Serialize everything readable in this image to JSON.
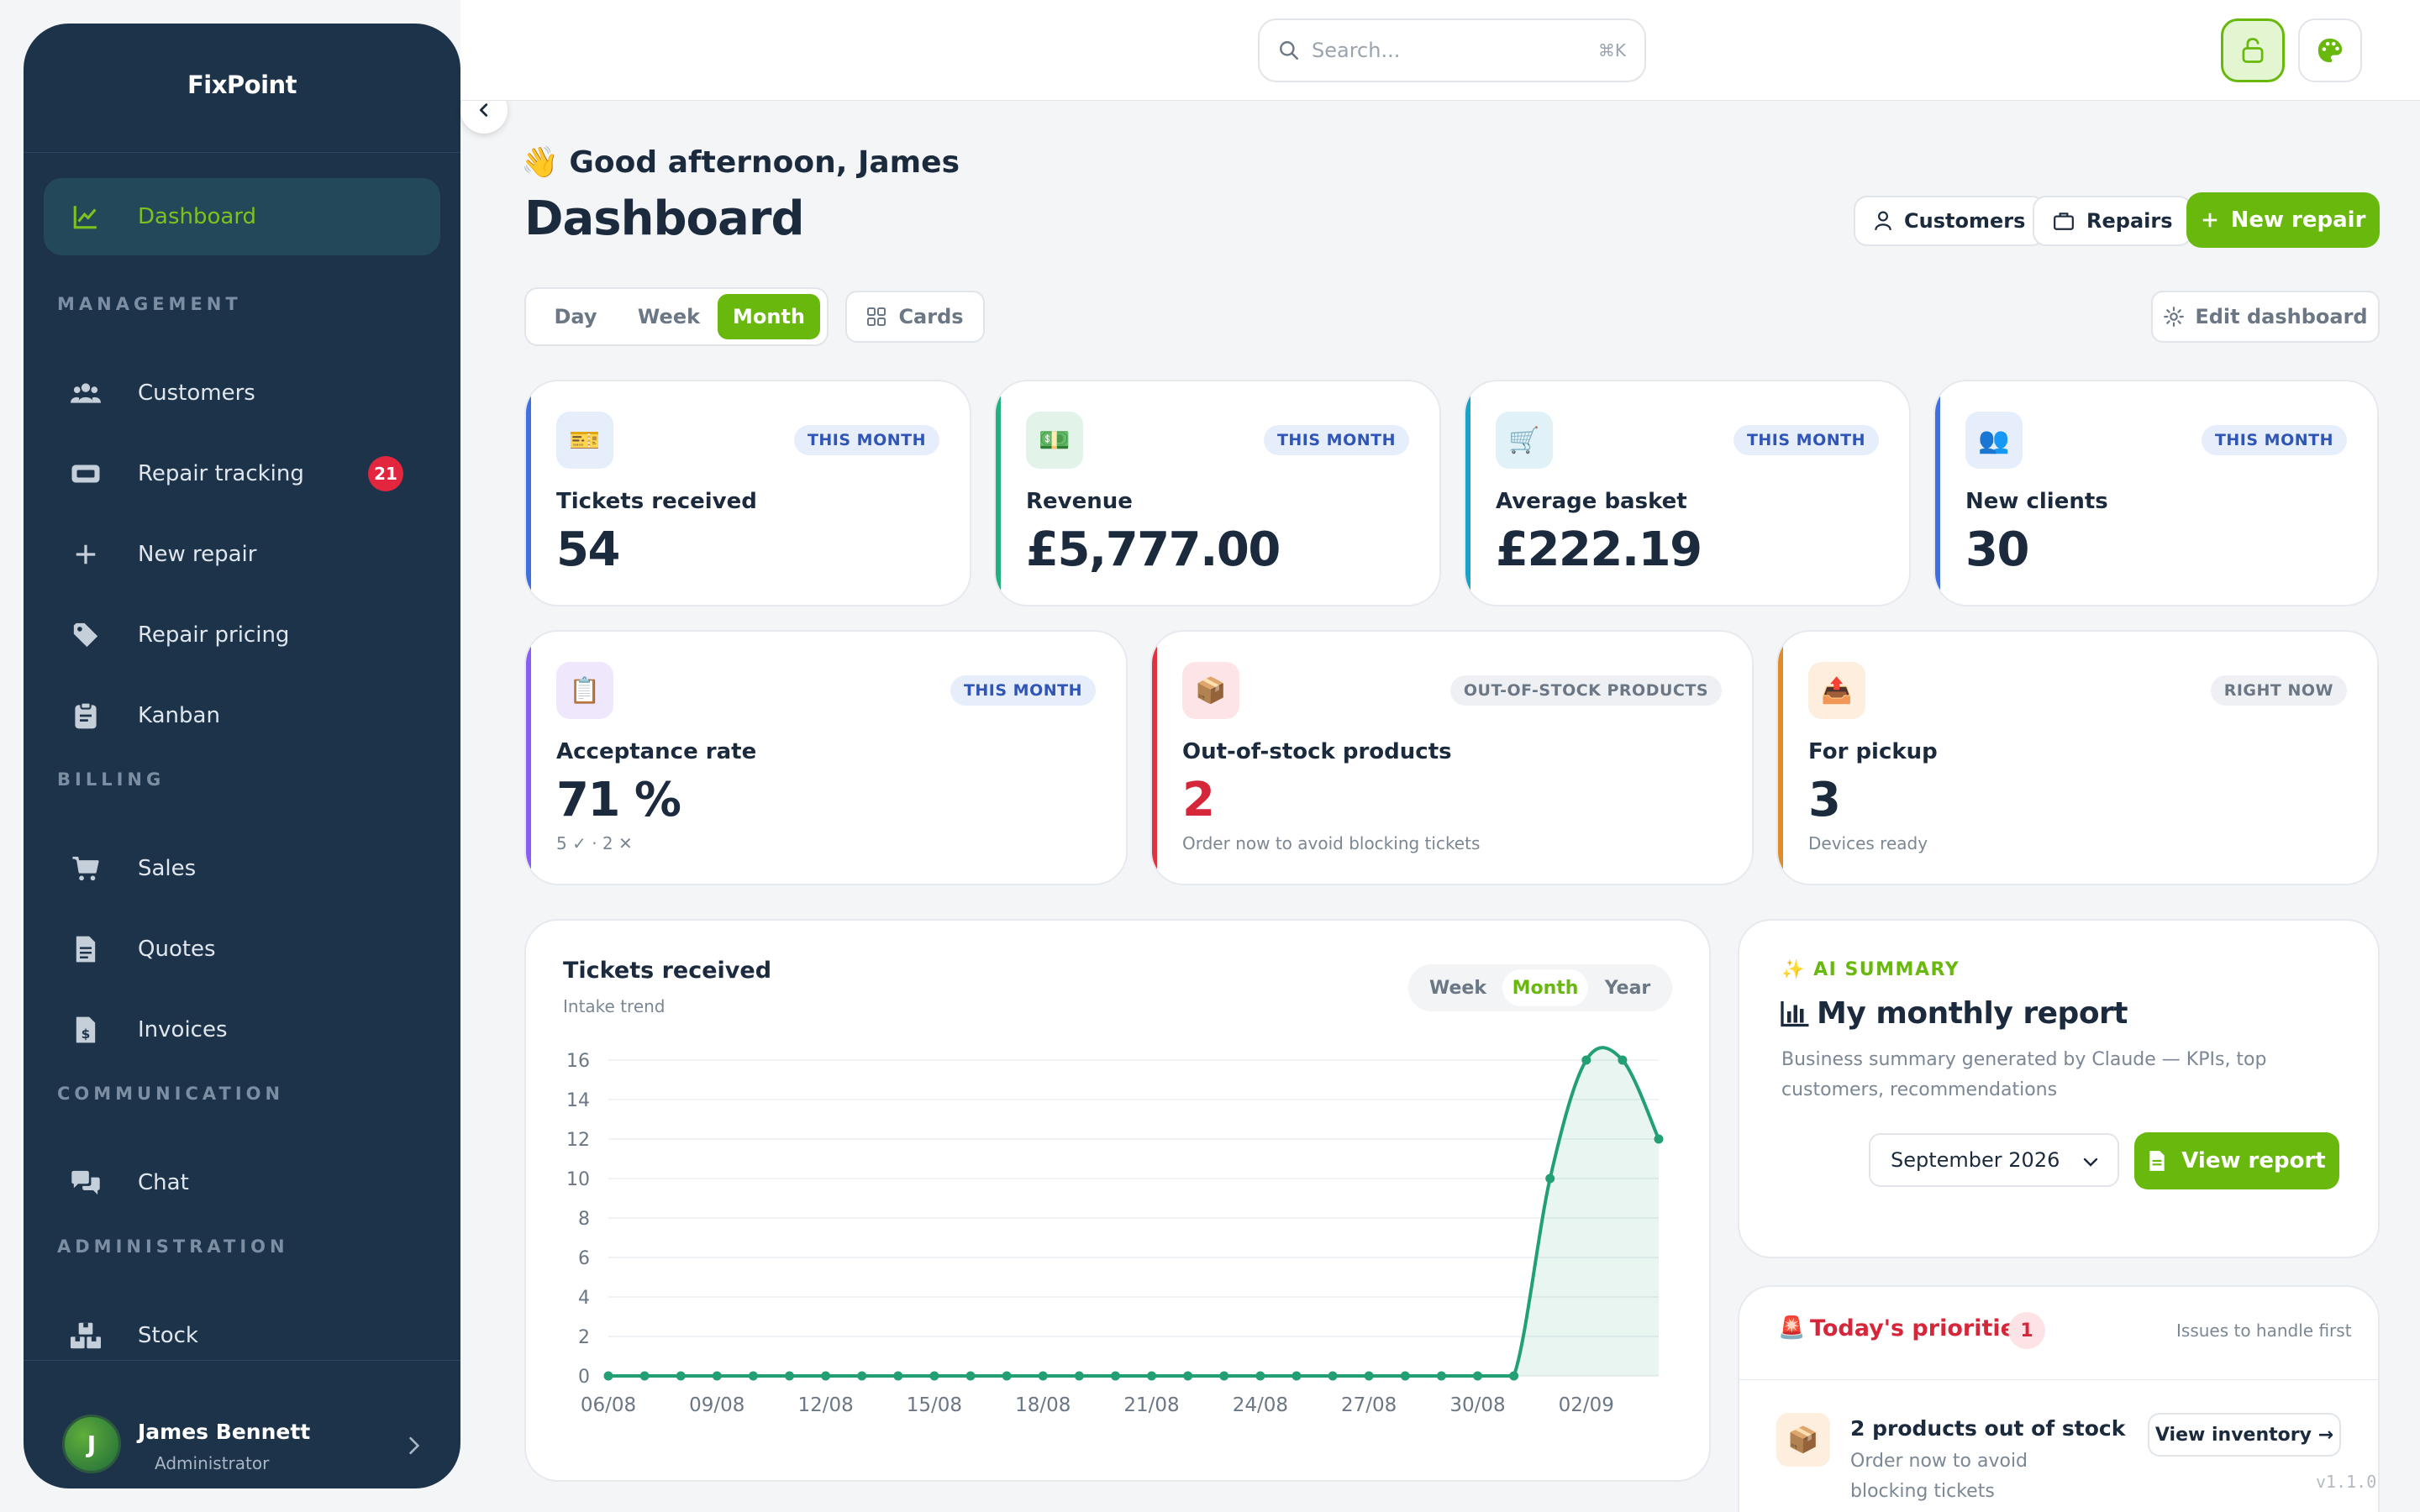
{
  "app": {
    "brand": "FixPoint"
  },
  "sidebar": {
    "items": [
      {
        "label": "Dashboard"
      },
      {
        "label": "Customers"
      },
      {
        "label": "Repair tracking",
        "badge": "21"
      },
      {
        "label": "New repair"
      },
      {
        "label": "Repair pricing"
      },
      {
        "label": "Kanban"
      },
      {
        "label": "Sales"
      },
      {
        "label": "Quotes"
      },
      {
        "label": "Invoices"
      },
      {
        "label": "Chat"
      },
      {
        "label": "Stock"
      }
    ],
    "sections": {
      "management": "MANAGEMENT",
      "billing": "BILLING",
      "communication": "COMMUNICATION",
      "administration": "ADMINISTRATION"
    },
    "user": {
      "initial": "J",
      "name": "James Bennett",
      "role": "Administrator"
    }
  },
  "topbar": {
    "search_placeholder": "Search...",
    "search_shortcut": "⌘K"
  },
  "header": {
    "greeting_emoji": "👋",
    "greeting": "Good afternoon, James",
    "title": "Dashboard",
    "customers_button": "Customers",
    "repairs_button": "Repairs",
    "new_repair_button": "New repair"
  },
  "period": {
    "options": [
      "Day",
      "Week",
      "Month"
    ],
    "selected": "Month",
    "cards_button": "Cards",
    "edit_button": "Edit dashboard"
  },
  "kpis": [
    {
      "icon": "🎫",
      "tag": "THIS MONTH",
      "label": "Tickets received",
      "value": "54",
      "accent": "#3f6fe0"
    },
    {
      "icon": "💵",
      "tag": "THIS MONTH",
      "label": "Revenue",
      "value": "£5,777.00",
      "accent": "#22b07d"
    },
    {
      "icon": "🛒",
      "tag": "THIS MONTH",
      "label": "Average basket",
      "value": "£222.19",
      "accent": "#1aa3c9"
    },
    {
      "icon": "👥",
      "tag": "THIS MONTH",
      "label": "New clients",
      "value": "30",
      "accent": "#3f6fe0"
    },
    {
      "icon": "📋",
      "tag": "THIS MONTH",
      "label": "Acceptance rate",
      "value": "71 %",
      "sub": "5 ✓ · 2 ✕",
      "accent": "#8b5cf6"
    },
    {
      "icon": "📦",
      "tag": "OUT-OF-STOCK PRODUCTS",
      "label": "Out-of-stock products",
      "value": "2",
      "sub": "Order now to avoid blocking tickets",
      "accent": "#e0333f",
      "value_color": "#d5263a"
    },
    {
      "icon": "📤",
      "tag": "RIGHT NOW",
      "label": "For pickup",
      "value": "3",
      "sub": "Devices ready",
      "accent": "#e08a2a"
    }
  ],
  "trend": {
    "title": "Tickets received",
    "subtitle": "Intake trend",
    "tabs": [
      "Week",
      "Month",
      "Year"
    ],
    "selected": "Month"
  },
  "chart_data": {
    "type": "area",
    "x_tick_labels": [
      "06/08",
      "09/08",
      "12/08",
      "15/08",
      "18/08",
      "21/08",
      "24/08",
      "27/08",
      "30/08",
      "02/09"
    ],
    "x": [
      "06/08",
      "07/08",
      "08/08",
      "09/08",
      "10/08",
      "11/08",
      "12/08",
      "13/08",
      "14/08",
      "15/08",
      "16/08",
      "17/08",
      "18/08",
      "19/08",
      "20/08",
      "21/08",
      "22/08",
      "23/08",
      "24/08",
      "25/08",
      "26/08",
      "27/08",
      "28/08",
      "29/08",
      "30/08",
      "31/08",
      "01/09",
      "02/09",
      "03/09",
      "04/09"
    ],
    "values": [
      0,
      0,
      0,
      0,
      0,
      0,
      0,
      0,
      0,
      0,
      0,
      0,
      0,
      0,
      0,
      0,
      0,
      0,
      0,
      0,
      0,
      0,
      0,
      0,
      0,
      0,
      10,
      16,
      16,
      12
    ],
    "ylim": [
      0,
      16
    ],
    "y_ticks": [
      0,
      2,
      4,
      6,
      8,
      10,
      12,
      14,
      16
    ],
    "grid": true,
    "color": "#22a073"
  },
  "ai": {
    "label": "AI SUMMARY",
    "title": "My monthly report",
    "description": "Business summary generated by Claude — KPIs, top customers, recommendations",
    "month": "September 2026",
    "view_button": "View report"
  },
  "priorities": {
    "title": "Today's priorities",
    "count": "1",
    "hint": "Issues to handle first",
    "item_title": "2 products out of stock",
    "item_sub": "Order now to avoid blocking tickets",
    "item_button": "View inventory →"
  },
  "version": "v1.1.0"
}
